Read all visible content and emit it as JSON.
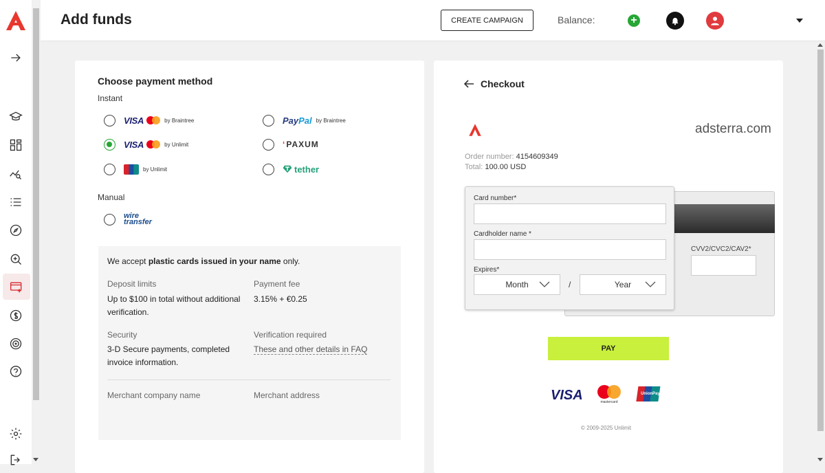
{
  "header": {
    "title": "Add funds",
    "create_campaign": "CREATE CAMPAIGN",
    "balance_label": "Balance:",
    "add_balance": "+"
  },
  "sidebar": {
    "items": [
      {
        "icon": "expand-arrow-icon"
      },
      {
        "icon": "academy-icon"
      },
      {
        "icon": "dashboard-icon"
      },
      {
        "icon": "statistics-icon"
      },
      {
        "icon": "campaigns-list-icon"
      },
      {
        "icon": "explore-icon"
      },
      {
        "icon": "search-analytics-icon"
      },
      {
        "icon": "add-funds-icon",
        "active": true
      },
      {
        "icon": "finance-icon"
      },
      {
        "icon": "targeting-icon"
      },
      {
        "icon": "help-icon"
      },
      {
        "icon": "settings-icon"
      },
      {
        "icon": "logout-icon"
      }
    ],
    "accent": "#d7262e"
  },
  "payment": {
    "title": "Choose payment method",
    "instant_label": "Instant",
    "manual_label": "Manual",
    "options": {
      "visa_braintree": {
        "brand": "VISA",
        "by": "by Braintree",
        "checked": false
      },
      "paypal_braintree": {
        "brand_a": "Pay",
        "brand_b": "Pal",
        "by": "by Braintree",
        "checked": false
      },
      "visa_unlimit": {
        "brand": "VISA",
        "by": "by Unlimit",
        "checked": true
      },
      "paxum": {
        "brand": "PAXUM",
        "checked": false
      },
      "unionpay_unlimit": {
        "by": "by Unlimit",
        "checked": false
      },
      "tether": {
        "brand": "tether",
        "checked": false
      },
      "wire": {
        "line1": "wire",
        "line2": "transfer",
        "checked": false
      }
    },
    "info": {
      "accept_pre": "We accept ",
      "accept_bold": "plastic cards issued in your name",
      "accept_post": " only.",
      "deposit_limits_label": "Deposit limits",
      "deposit_limits_value": "Up to $100 in total without additional verification.",
      "payment_fee_label": "Payment fee",
      "payment_fee_value": "3.15% + €0.25",
      "security_label": "Security",
      "security_value": "3-D Secure payments, completed invoice information.",
      "verification_label": "Verification required",
      "verification_link": "These and other details in FAQ",
      "merchant_company_label": "Merchant company name",
      "merchant_address_label": "Merchant address"
    }
  },
  "checkout": {
    "title": "Checkout",
    "domain": "adsterra.com",
    "order_number_label": "Order number:",
    "order_number": "4154609349",
    "total_label": "Total:",
    "total": "100.00 USD",
    "card_number_label": "Card number*",
    "cardholder_label": "Cardholder name *",
    "expires_label": "Expires*",
    "month_placeholder": "Month",
    "year_placeholder": "Year",
    "slash": "/",
    "cvv_label": "CVV2/CVC2/CAV2*",
    "pay_label": "PAY",
    "logos": {
      "visa": "VISA",
      "mastercard": "mastercard",
      "unionpay": "UnionPay"
    },
    "copyright": "© 2009-2025 Unlimit"
  },
  "colors": {
    "brand_red": "#e03a3e",
    "pay_green": "#c8f03c",
    "radio_green": "#27a635"
  }
}
